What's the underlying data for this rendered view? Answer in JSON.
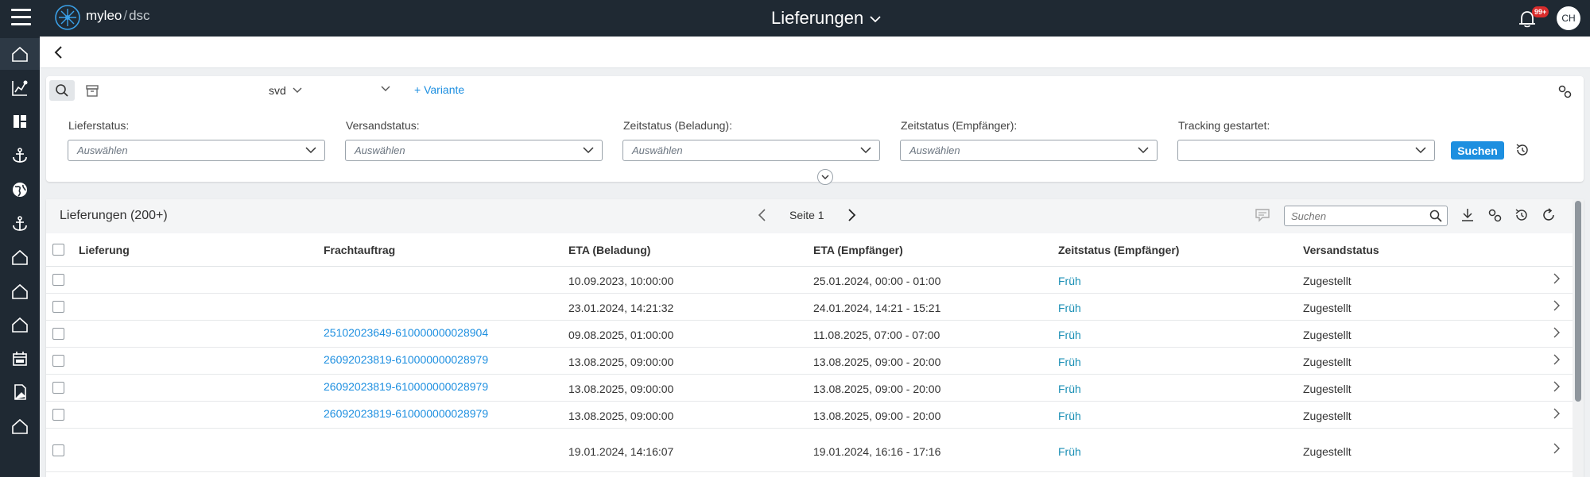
{
  "app": {
    "brand_name": "myleo",
    "brand_slash": "/",
    "brand_suffix": "dsc",
    "page_title": "Lieferungen",
    "notification_count": "99+",
    "user_initials": "CH"
  },
  "sidebar": {
    "items": [
      {
        "icon": "home-icon"
      },
      {
        "icon": "analytics-icon"
      },
      {
        "icon": "dashboard-icon"
      },
      {
        "icon": "anchor-icon"
      },
      {
        "icon": "globe-icon"
      },
      {
        "icon": "anchor-icon"
      },
      {
        "icon": "home-icon"
      },
      {
        "icon": "home-icon"
      },
      {
        "icon": "home-icon"
      },
      {
        "icon": "calendar-icon"
      },
      {
        "icon": "document-icon"
      },
      {
        "icon": "home-icon"
      }
    ]
  },
  "filters": {
    "variant_value": "svd",
    "add_variant_label": "+ Variante",
    "fields": [
      {
        "label": "Lieferstatus:",
        "placeholder": "Auswählen"
      },
      {
        "label": "Versandstatus:",
        "placeholder": "Auswählen"
      },
      {
        "label": "Zeitstatus (Beladung):",
        "placeholder": "Auswählen"
      },
      {
        "label": "Zeitstatus (Empfänger):",
        "placeholder": "Auswählen"
      },
      {
        "label": "Tracking gestartet:",
        "placeholder": ""
      }
    ],
    "search_button_label": "Suchen"
  },
  "table": {
    "title": "Lieferungen (200+)",
    "page_label": "Seite 1",
    "search_placeholder": "Suchen",
    "columns": [
      "Lieferung",
      "Frachtauftrag",
      "ETA (Beladung)",
      "ETA (Empfänger)",
      "Zeitstatus (Empfänger)",
      "Versandstatus"
    ],
    "rows": [
      {
        "lieferung": "",
        "frachtauftrag": "",
        "eta_beladung": "10.09.2023, 10:00:00",
        "eta_empfaenger": "25.01.2024, 00:00 - 01:00",
        "zeitstatus": "Früh",
        "versandstatus": "Zugestellt"
      },
      {
        "lieferung": "",
        "frachtauftrag": "",
        "eta_beladung": "23.01.2024, 14:21:32",
        "eta_empfaenger": "24.01.2024, 14:21 - 15:21",
        "zeitstatus": "Früh",
        "versandstatus": "Zugestellt"
      },
      {
        "lieferung": "",
        "frachtauftrag": "25102023649-610000000028904",
        "eta_beladung": "09.08.2025, 01:00:00",
        "eta_empfaenger": "11.08.2025, 07:00 - 07:00",
        "zeitstatus": "Früh",
        "versandstatus": "Zugestellt"
      },
      {
        "lieferung": "",
        "frachtauftrag": "26092023819-610000000028979",
        "eta_beladung": "13.08.2025, 09:00:00",
        "eta_empfaenger": "13.08.2025, 09:00 - 20:00",
        "zeitstatus": "Früh",
        "versandstatus": "Zugestellt"
      },
      {
        "lieferung": "",
        "frachtauftrag": "26092023819-610000000028979",
        "eta_beladung": "13.08.2025, 09:00:00",
        "eta_empfaenger": "13.08.2025, 09:00 - 20:00",
        "zeitstatus": "Früh",
        "versandstatus": "Zugestellt"
      },
      {
        "lieferung": "",
        "frachtauftrag": "26092023819-610000000028979",
        "eta_beladung": "13.08.2025, 09:00:00",
        "eta_empfaenger": "13.08.2025, 09:00 - 20:00",
        "zeitstatus": "Früh",
        "versandstatus": "Zugestellt"
      },
      {
        "lieferung": "",
        "frachtauftrag": "",
        "eta_beladung": "19.01.2024, 14:16:07",
        "eta_empfaenger": "19.01.2024, 16:16 - 17:16",
        "zeitstatus": "Früh",
        "versandstatus": "Zugestellt"
      }
    ]
  },
  "colors": {
    "topbar": "#1f2933",
    "accent": "#1d8fe0",
    "status_text": "#1a8fb5",
    "badge": "#d92c2c"
  }
}
